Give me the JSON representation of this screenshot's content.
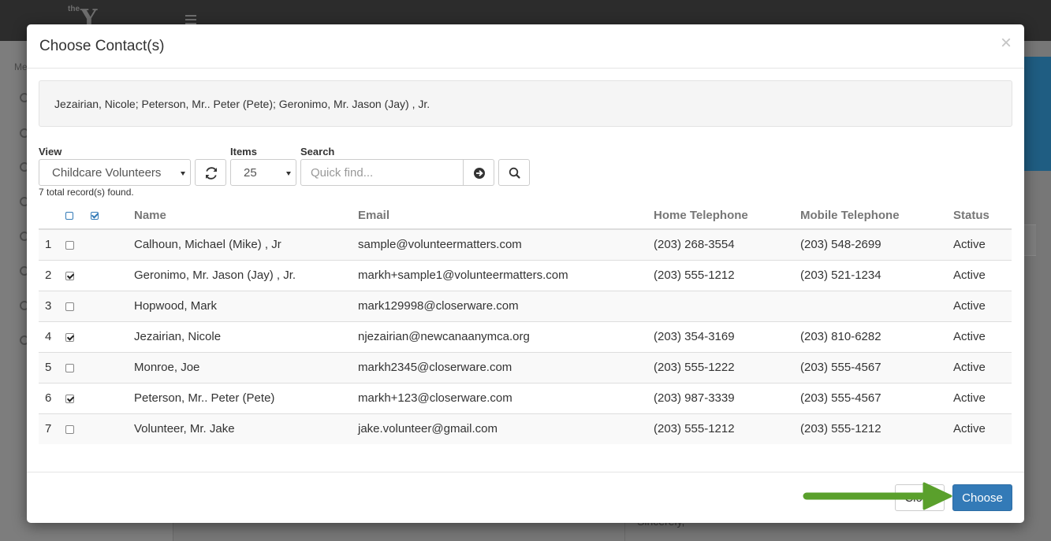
{
  "modal": {
    "title": "Choose Contact(s)",
    "close_glyph": "×",
    "selected_summary": "Jezairian, Nicole; Peterson, Mr.. Peter (Pete); Geronimo, Mr. Jason (Jay) , Jr."
  },
  "filters": {
    "view_label": "View",
    "view_value": "Childcare Volunteers",
    "items_label": "Items",
    "items_value": "25",
    "search_label": "Search",
    "search_placeholder": "Quick find...",
    "records_found": "7 total record(s) found."
  },
  "table": {
    "headers": {
      "name": "Name",
      "email": "Email",
      "home": "Home Telephone",
      "mobile": "Mobile Telephone",
      "status": "Status"
    },
    "rows": [
      {
        "num": "1",
        "checked": false,
        "name": "Calhoun, Michael (Mike) , Jr",
        "email": "sample@volunteermatters.com",
        "home": "(203) 268-3554",
        "mobile": "(203) 548-2699",
        "status": "Active"
      },
      {
        "num": "2",
        "checked": true,
        "name": "Geronimo, Mr. Jason (Jay) , Jr.",
        "email": "markh+sample1@volunteermatters.com",
        "home": "(203) 555-1212",
        "mobile": "(203) 521-1234",
        "status": "Active"
      },
      {
        "num": "3",
        "checked": false,
        "name": "Hopwood, Mark",
        "email": "mark129998@closerware.com",
        "home": "",
        "mobile": "",
        "status": "Active"
      },
      {
        "num": "4",
        "checked": true,
        "name": "Jezairian, Nicole",
        "email": "njezairian@newcanaanymca.org",
        "home": "(203) 354-3169",
        "mobile": "(203) 810-6282",
        "status": "Active"
      },
      {
        "num": "5",
        "checked": false,
        "name": "Monroe, Joe",
        "email": "markh2345@closerware.com",
        "home": "(203) 555-1222",
        "mobile": "(203) 555-4567",
        "status": "Active"
      },
      {
        "num": "6",
        "checked": true,
        "name": "Peterson, Mr.. Peter (Pete)",
        "email": "markh+123@closerware.com",
        "home": "(203) 987-3339",
        "mobile": "(203) 555-4567",
        "status": "Active"
      },
      {
        "num": "7",
        "checked": false,
        "name": "Volunteer, Mr. Jake",
        "email": "jake.volunteer@gmail.com",
        "home": "(203) 555-1212",
        "mobile": "(203) 555-1212",
        "status": "Active"
      }
    ]
  },
  "footer": {
    "close_label": "Close",
    "choose_label": "Choose"
  },
  "background": {
    "logo_text": "Y",
    "logo_small": "the",
    "sidebar_label": "Me",
    "letter_text": "Sincerely,"
  },
  "colors": {
    "primary": "#337ab7",
    "arrow": "#5aa02c"
  }
}
